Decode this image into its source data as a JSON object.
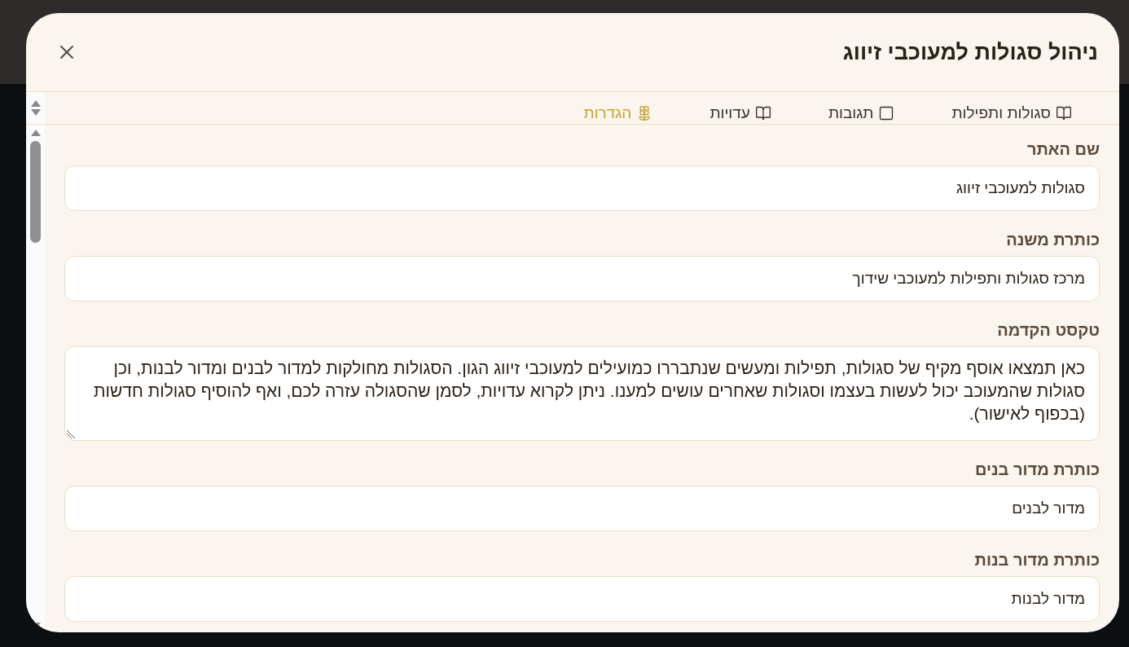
{
  "dialog": {
    "title": "ניהול סגולות למעוכבי זיווג"
  },
  "tabs": [
    {
      "label": "סגולות ותפילות",
      "kind": "book",
      "selected": false
    },
    {
      "label": "תגובות",
      "kind": "message",
      "selected": false
    },
    {
      "label": "עדויות",
      "kind": "book",
      "selected": false
    },
    {
      "label": "הגדרות",
      "kind": "settings",
      "selected": true
    }
  ],
  "fields": [
    {
      "kind": "input",
      "label": "שם האתר",
      "value": "סגולות למעוכבי זיווג"
    },
    {
      "kind": "input",
      "label": "כותרת משנה",
      "value": "מרכז סגולות ותפילות למעוכבי שידוך"
    },
    {
      "kind": "textarea",
      "label": "טקסט הקדמה",
      "value": "כאן תמצאו אוסף מקיף של סגולות, תפילות ומעשים שנתבררו כמועילים למעוכבי זיווג הגון. הסגולות מחולקות למדור לבנים ומדור לבנות, וכן סגולות שהמעוכב יכול לעשות בעצמו וסגולות שאחרים עושים למענו. ניתן לקרוא עדויות, לסמן שהסגולה עזרה לכם, ואף להוסיף סגולות חדשות (בכפוף לאישור)."
    },
    {
      "kind": "input",
      "label": "כותרת מדור בנים",
      "value": "מדור לבנים"
    },
    {
      "kind": "input",
      "label": "כותרת מדור בנות",
      "value": "מדור לבנות"
    }
  ]
}
